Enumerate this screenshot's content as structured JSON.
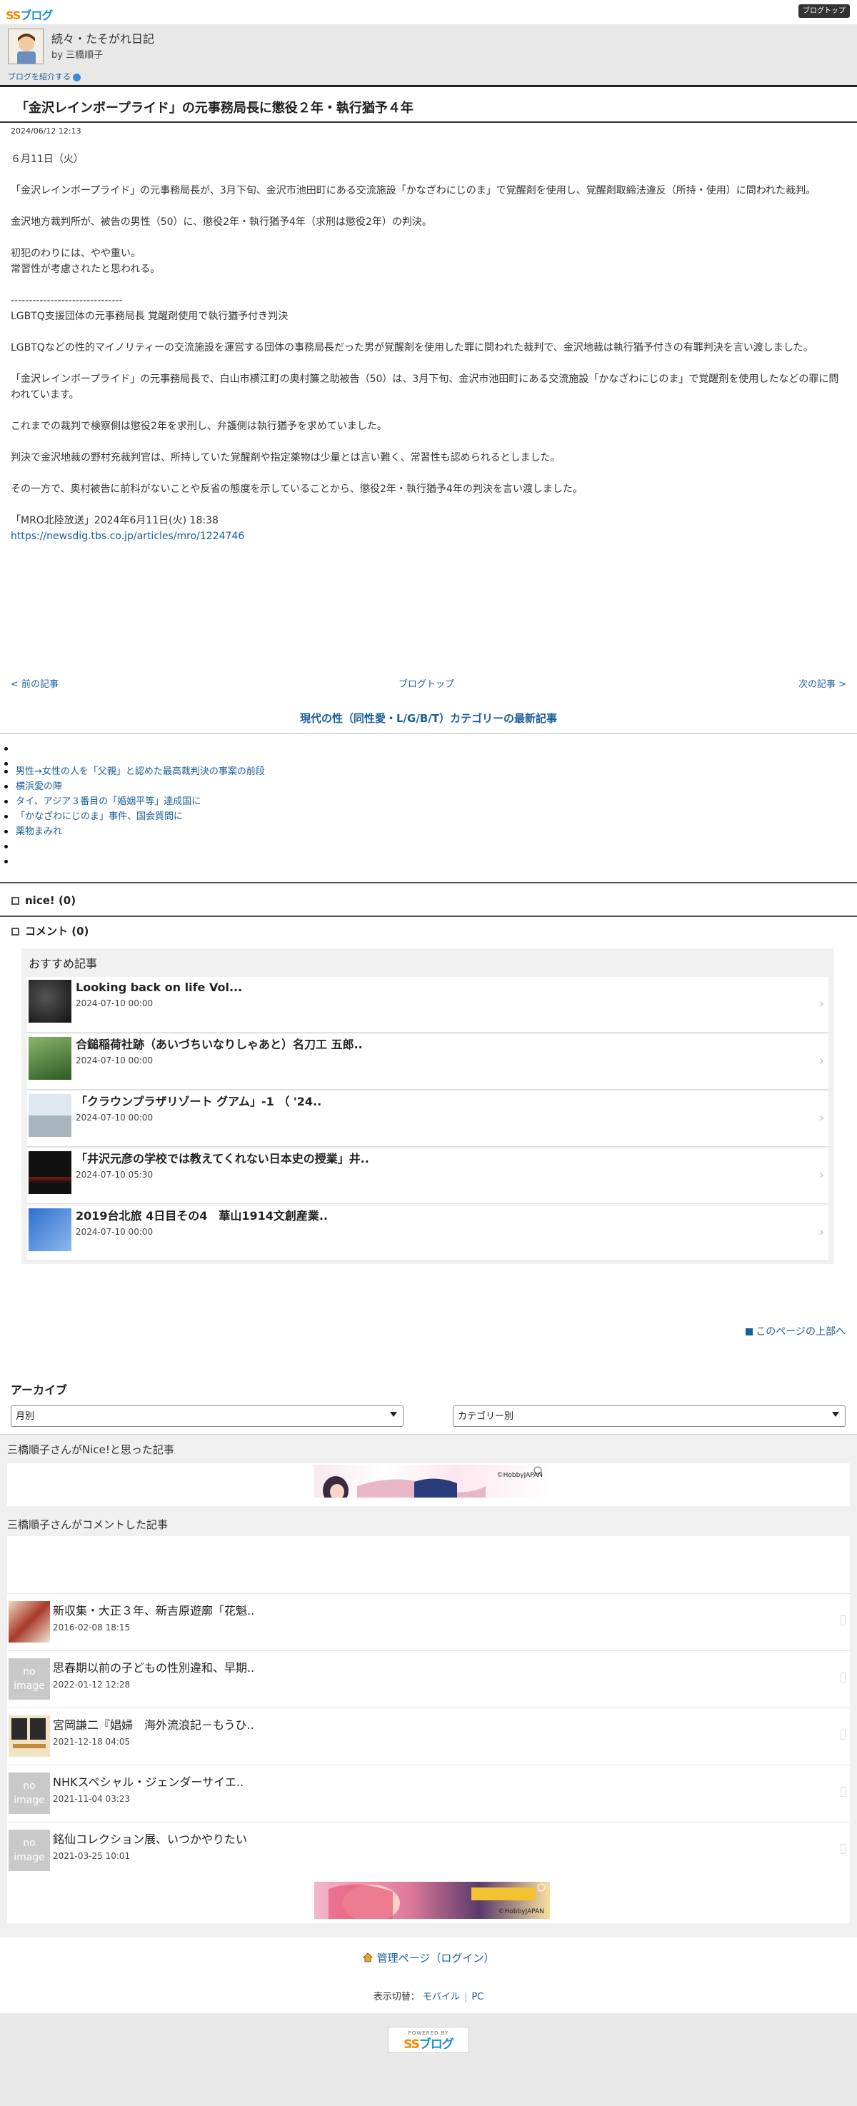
{
  "topbar": {
    "logo_ss": "SS",
    "logo_blog": "ブログ",
    "top_button": "ブログトップ"
  },
  "blog": {
    "title": "続々・たそがれ日記",
    "author": "by 三橋順子",
    "share_link": "ブログを紹介する"
  },
  "article": {
    "title": "「金沢レインボープライド」の元事務局長に懲役２年・執行猶予４年",
    "date": "2024/06/12 12:13",
    "paragraphs": [
      "６月11日（火）",
      "「金沢レインボープライド」の元事務局長が、3月下旬、金沢市池田町にある交流施設「かなざわにじのま」で覚醒剤を使用し、覚醒剤取締法違反（所持・使用）に問われた裁判。",
      "金沢地方裁判所が、被告の男性（50）に、懲役2年・執行猶予4年（求刑は懲役2年）の判決。",
      "初犯のわりには、やや重い。\n常習性が考慮されたと思われる。",
      "-------------------------------\nLGBTQ支援団体の元事務局長 覚醒剤使用で執行猶予付き判決",
      "LGBTQなどの性的マイノリティーの交流施設を運営する団体の事務局長だった男が覚醒剤を使用した罪に問われた裁判で、金沢地裁は執行猶予付きの有罪判決を言い渡しました。",
      "「金沢レインボープライド」の元事務局長で、白山市横江町の奥村簾之助被告（50）は、3月下旬、金沢市池田町にある交流施設「かなざわにじのま」で覚醒剤を使用したなどの罪に問われています。",
      "これまでの裁判で検察側は懲役2年を求刑し、弁護側は執行猶予を求めていました。",
      "判決で金沢地裁の野村充裁判官は、所持していた覚醒剤や指定薬物は少量とは言い難く、常習性も認められるとしました。",
      "その一方で、奥村被告に前科がないことや反省の態度を示していることから、懲役2年・執行猶予4年の判決を言い渡しました。"
    ],
    "source_line": "「MRO北陸放送」2024年6月11日(火) 18:38",
    "source_url": "https://newsdig.tbs.co.jp/articles/mro/1224746"
  },
  "nav": {
    "prev": "< 前の記事",
    "top": "ブログトップ",
    "next": "次の記事 >"
  },
  "category": {
    "heading": "現代の性（同性愛・L/G/B/T）カテゴリーの最新記事",
    "items": [
      "",
      "",
      "男性→女性の人を「父親」と認めた最高裁判決の事案の前段",
      "横浜愛の陣",
      "タイ、アジア３番目の「婚姻平等」達成国に",
      "「かなざわにじのま」事件、国会質問に",
      "薬物まみれ",
      "",
      ""
    ]
  },
  "nice": {
    "label": "nice! (0)"
  },
  "comments": {
    "label": "コメント (0)"
  },
  "recommended": {
    "title": "おすすめ記事",
    "items": [
      {
        "name": "Looking back on life Vol...",
        "date": "2024-07-10 00:00",
        "thumb_color": "#222222"
      },
      {
        "name": "合鎚稲荷社跡（あいづちいなりしゃあと）名刀工 五郎..",
        "date": "2024-07-10 00:00",
        "thumb_color": "#3f7a3a"
      },
      {
        "name": "「クラウンプラザリゾート グアム」-1 （ '24..",
        "date": "2024-07-10 00:00",
        "thumb_color": "#c7d3df"
      },
      {
        "name": "「井沢元彦の学校では教えてくれない日本史の授業」井..",
        "date": "2024-07-10 05:30",
        "thumb_color": "#111111"
      },
      {
        "name": "2019台北旅 4日目その4　華山1914文創産業..",
        "date": "2024-07-10 00:00",
        "thumb_color": "#3d7fd6"
      }
    ]
  },
  "page_top": "このページの上部へ",
  "archive": {
    "heading": "アーカイブ",
    "monthly": "月別",
    "category": "カテゴリー別"
  },
  "nice_articles": {
    "heading": "三橋順子さんがNice!と思った記事",
    "ad_label": "©HobbyJAPAN"
  },
  "commented_articles": {
    "heading": "三橋順子さんがコメントした記事",
    "items": [
      {
        "name": "新収集・大正３年、新吉原遊廓「花魁..",
        "date": "2016-02-08 18:15",
        "thumb": "image",
        "thumb_color": "#8a3a2a"
      },
      {
        "name": "思春期以前の子どもの性別違和、早期..",
        "date": "2022-01-12 12:28",
        "thumb": "noimage",
        "thumb_color": "#c9c9c9"
      },
      {
        "name": "宮岡謙二『娼婦　海外流浪記－もうひ..",
        "date": "2021-12-18 04:05",
        "thumb": "image",
        "thumb_color": "#e6d6b0"
      },
      {
        "name": "NHKスペシャル・ジェンダーサイエ..",
        "date": "2021-11-04 03:23",
        "thumb": "noimage",
        "thumb_color": "#c9c9c9"
      },
      {
        "name": "銘仙コレクション展、いつかやりたい",
        "date": "2021-03-25 10:01",
        "thumb": "noimage",
        "thumb_color": "#c9c9c9"
      }
    ],
    "noimage_label": "no image",
    "ad_label": "©HobbyJAPAN"
  },
  "footer": {
    "admin_link": "管理ページ（ログイン）",
    "mode_label": "表示切替：",
    "mode_mobile": "モバイル",
    "mode_pc": "PC",
    "powered_by": "POWERED BY",
    "logo_ss": "SS",
    "logo_blog": "ブログ"
  }
}
